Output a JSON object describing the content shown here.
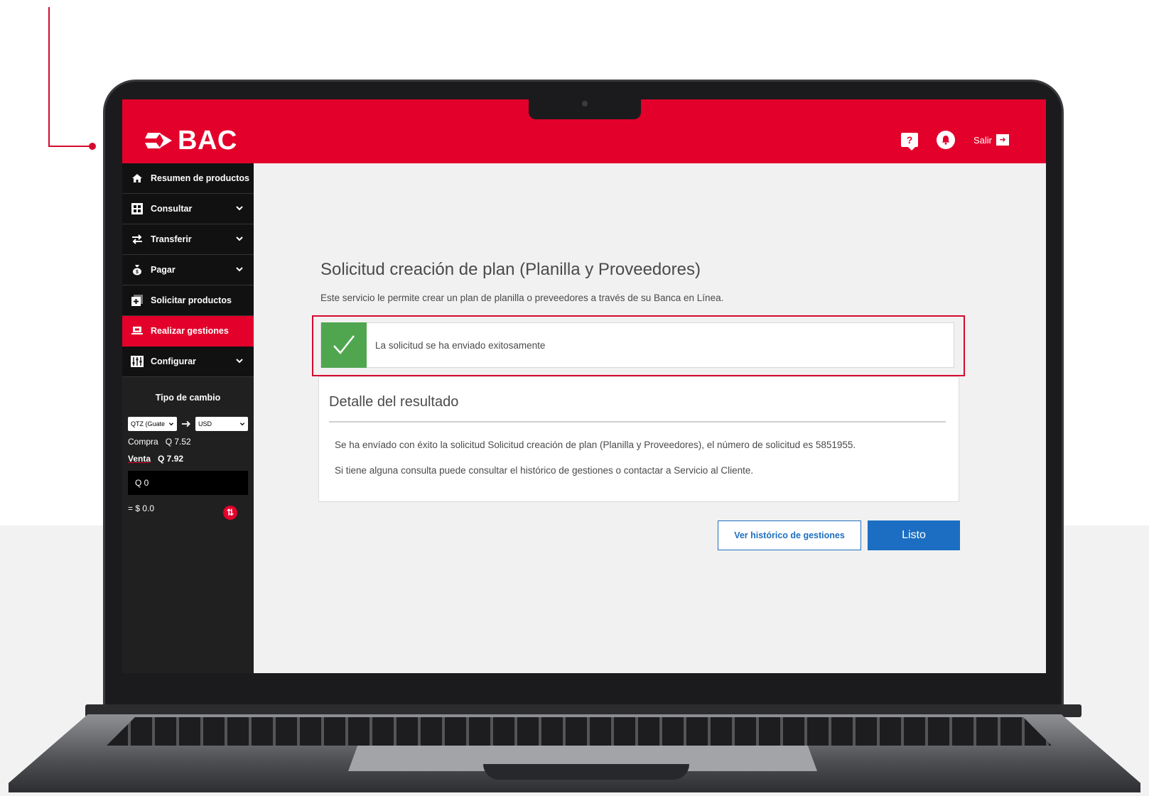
{
  "header": {
    "brand": "BAC",
    "help_label": "?",
    "logout_label": "Salir",
    "colors": {
      "brand_red": "#e3002b",
      "primary_blue": "#1b6ec2",
      "success_green": "#4fa64f"
    }
  },
  "sidebar": {
    "items": [
      {
        "label": "Resumen de productos",
        "icon": "home-icon"
      },
      {
        "label": "Consultar",
        "icon": "grid-icon"
      },
      {
        "label": "Transferir",
        "icon": "transfer-icon"
      },
      {
        "label": "Pagar",
        "icon": "money-bag-icon"
      },
      {
        "label": "Solicitar productos",
        "icon": "add-product-icon"
      },
      {
        "label": "Realizar gestiones",
        "icon": "laptop-icon"
      },
      {
        "label": "Configurar",
        "icon": "sliders-icon"
      }
    ]
  },
  "exchange": {
    "title": "Tipo de cambio",
    "from": "QTZ (Guate",
    "to": "USD",
    "buy_label": "Compra",
    "buy_value": "Q 7.52",
    "sell_label": "Venta",
    "sell_value": "Q 7.92",
    "input_value": "Q  0",
    "result": "= $ 0.0"
  },
  "main": {
    "title": "Solicitud creación de plan (Planilla y Proveedores)",
    "description": "Este servicio le permite crear un plan de planilla o preveedores a través de su Banca en Línea.",
    "success_message": "La solicitud se ha enviado exitosamente",
    "detail_title": "Detalle del resultado",
    "detail_line1": "Se ha envíado con éxito la solicitud Solicitud creación de plan (Planilla y Proveedores), el número de solicitud es 5851955.",
    "detail_line2": "Si tiene alguna consulta puede consultar el histórico de gestiones o contactar a Servicio al Cliente.",
    "history_button": "Ver histórico de gestiones",
    "done_button": "Listo"
  }
}
